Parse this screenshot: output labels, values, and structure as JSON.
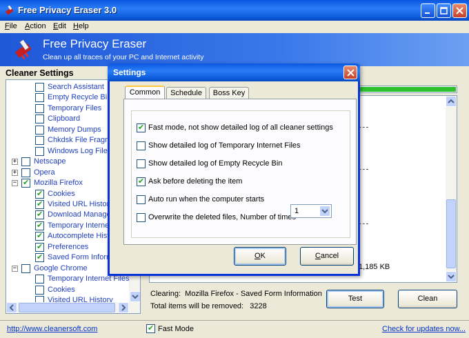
{
  "window": {
    "title": "Free Privacy Eraser 3.0"
  },
  "menu": {
    "items": [
      {
        "label": "File",
        "key": "F"
      },
      {
        "label": "Action",
        "key": "A"
      },
      {
        "label": "Edit",
        "key": "E"
      },
      {
        "label": "Help",
        "key": "H"
      }
    ]
  },
  "banner": {
    "title": "Free Privacy Eraser",
    "subtitle": "Clean up all traces of your PC and Internet activity"
  },
  "cleaner": {
    "header": "Cleaner Settings",
    "tree": [
      {
        "label": "Search Assistant",
        "checked": false,
        "level": 2
      },
      {
        "label": "Empty Recycle Bin",
        "checked": false,
        "level": 2
      },
      {
        "label": "Temporary Files",
        "checked": false,
        "level": 2
      },
      {
        "label": "Clipboard",
        "checked": false,
        "level": 2
      },
      {
        "label": "Memory Dumps",
        "checked": false,
        "level": 2
      },
      {
        "label": "Chkdsk File Fragmen",
        "checked": false,
        "level": 2
      },
      {
        "label": "Windows Log Files",
        "checked": false,
        "level": 2
      },
      {
        "label": "Netscape",
        "checked": false,
        "level": 1,
        "expander": "+"
      },
      {
        "label": "Opera",
        "checked": false,
        "level": 1,
        "expander": "+"
      },
      {
        "label": "Mozilla Firefox",
        "checked": true,
        "level": 1,
        "expander": "-"
      },
      {
        "label": "Cookies",
        "checked": true,
        "level": 2
      },
      {
        "label": "Visited URL History",
        "checked": true,
        "level": 2
      },
      {
        "label": "Download Manager",
        "checked": true,
        "level": 2
      },
      {
        "label": "Temporary Internet",
        "checked": true,
        "level": 2
      },
      {
        "label": "Autocomplete Histo",
        "checked": true,
        "level": 2
      },
      {
        "label": "Preferences",
        "checked": true,
        "level": 2
      },
      {
        "label": "Saved Form Informa",
        "checked": true,
        "level": 2
      },
      {
        "label": "Google Chrome",
        "checked": false,
        "level": 1,
        "expander": "-"
      },
      {
        "label": "Temporary Internet Files",
        "checked": false,
        "level": 2
      },
      {
        "label": "Cookies",
        "checked": false,
        "level": 2
      },
      {
        "label": "Visited URL History",
        "checked": false,
        "level": 2
      }
    ]
  },
  "progress": {
    "value": 1.0,
    "color": "#2ec12e"
  },
  "log": {
    "size_text": "1,185 KB"
  },
  "status": {
    "clearing_label": "Clearing:",
    "clearing_value": "Mozilla Firefox - Saved Form Information",
    "total_label": "Total items will be removed:",
    "total_value": "3228"
  },
  "buttons": {
    "test": "Test",
    "clean": "Clean"
  },
  "footer": {
    "url": "http://www.cleanersoft.com",
    "fast_mode": "Fast Mode",
    "fast_mode_checked": true,
    "updates": "Check for updates now..."
  },
  "dialog": {
    "title": "Settings",
    "tabs": [
      {
        "label": "Common",
        "active": true
      },
      {
        "label": "Schedule",
        "active": false
      },
      {
        "label": "Boss Key",
        "active": false
      }
    ],
    "options": [
      {
        "label": "Fast mode, not show detailed log of all cleaner settings",
        "checked": true
      },
      {
        "label": "Show detailed log of Temporary Internet Files",
        "checked": false
      },
      {
        "label": "Show detailed log of Empty Recycle Bin",
        "checked": false
      },
      {
        "label": "Ask before deleting the item",
        "checked": true
      },
      {
        "label": "Auto run when the computer starts",
        "checked": false
      },
      {
        "label": "Overwrite the deleted files, Number of times",
        "checked": false
      }
    ],
    "overwrite_times": "1",
    "ok": "OK",
    "ok_key": "O",
    "cancel": "Cancel",
    "cancel_key": "C"
  },
  "colors": {
    "titlebar": "#0a58e0",
    "link": "#0033cc",
    "tree_text": "#1f3fbf",
    "check": "#21a121"
  }
}
